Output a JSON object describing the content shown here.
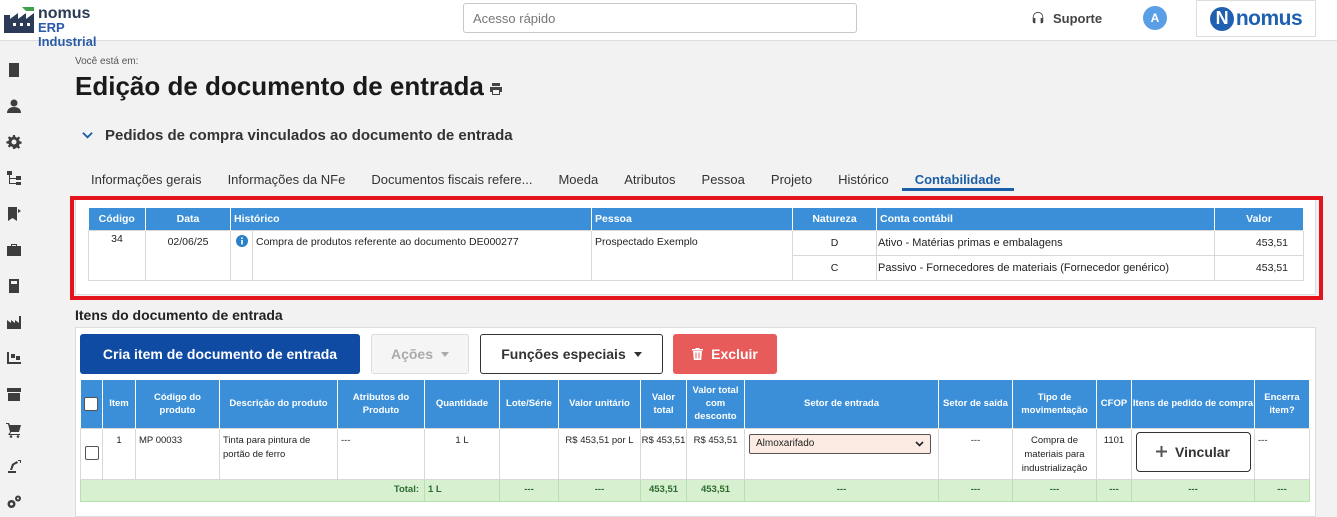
{
  "app": {
    "logo_line1": "nomus",
    "logo_line2": "ERP Industrial",
    "search_placeholder": "Acesso rápido",
    "support_label": "Suporte",
    "avatar_initial": "A",
    "brand_text": "nomus",
    "brand_initial": "N"
  },
  "sidebar": {
    "icons": [
      "document-icon",
      "user-icon",
      "gear-icon",
      "hierarchy-icon",
      "bookmark-icon",
      "briefcase-icon",
      "book-icon",
      "factory-icon",
      "warehouse-icon",
      "archive-icon",
      "cart-icon",
      "robot-arm-icon",
      "gears-icon"
    ]
  },
  "page": {
    "breadcrumb": "Você está em:",
    "title": "Edição de documento de entrada"
  },
  "section": {
    "title": "Pedidos de compra vinculados ao documento de entrada"
  },
  "tabs": [
    {
      "label": "Informações gerais",
      "active": false
    },
    {
      "label": "Informações da NFe",
      "active": false
    },
    {
      "label": "Documentos fiscais refere...",
      "active": false
    },
    {
      "label": "Moeda",
      "active": false
    },
    {
      "label": "Atributos",
      "active": false
    },
    {
      "label": "Pessoa",
      "active": false
    },
    {
      "label": "Projeto",
      "active": false
    },
    {
      "label": "Histórico",
      "active": false
    },
    {
      "label": "Contabilidade",
      "active": true
    }
  ],
  "accounting": {
    "headers": [
      "Código",
      "Data",
      "Histórico",
      "Pessoa",
      "Natureza",
      "Conta contábil",
      "Valor"
    ],
    "entry": {
      "codigo": "34",
      "data": "02/06/25",
      "historico": "Compra de produtos referente ao documento DE000277",
      "pessoa": "Prospectado Exemplo"
    },
    "lines": [
      {
        "natureza": "D",
        "conta": "Ativo - Matérias primas e embalagens",
        "valor": "453,51"
      },
      {
        "natureza": "C",
        "conta": "Passivo - Fornecedores de materiais (Fornecedor genérico)",
        "valor": "453,51"
      }
    ]
  },
  "items": {
    "title": "Itens do documento de entrada",
    "buttons": {
      "create": "Cria item de documento de entrada",
      "acoes": "Ações",
      "funcoes": "Funções especiais",
      "excluir": "Excluir"
    },
    "headers": [
      "Item",
      "Código do produto",
      "Descrição do produto",
      "Atributos do Produto",
      "Quantidade",
      "Lote/Série",
      "Valor unitário",
      "Valor total",
      "Valor total com desconto",
      "Setor de entrada",
      "Setor de saída",
      "Tipo de movimentação",
      "CFOP",
      "Itens de pedido de compra",
      "Encerra item?"
    ],
    "row": {
      "item": "1",
      "codigo": "MP 00033",
      "descricao": "Tinta para pintura de portão de ferro",
      "atributos": "---",
      "quantidade": "1 L",
      "lote": "",
      "valor_unitario": "R$ 453,51 por L",
      "valor_total": "R$ 453,51",
      "valor_desconto": "R$ 453,51",
      "setor_entrada": "Almoxarifado",
      "setor_saida": "---",
      "tipo_mov": "Compra de materiais para industrialização",
      "cfop": "1101",
      "vincular": "Vincular",
      "encerra": "---"
    },
    "total": {
      "label": "Total:",
      "quantidade": "1 L",
      "lote": "---",
      "valor_unitario": "---",
      "valor_total": "453,51",
      "valor_desconto": "453,51",
      "setor_entrada": "---",
      "setor_saida": "---",
      "tipo_mov": "---",
      "cfop": "---",
      "itens_pedido": "---",
      "encerra": "---"
    }
  }
}
